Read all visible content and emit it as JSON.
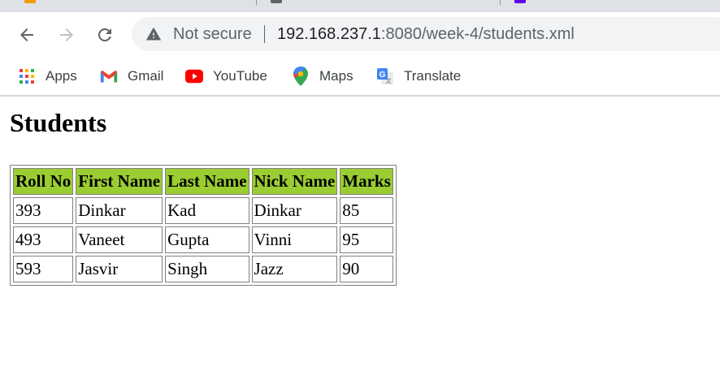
{
  "browser": {
    "security_label": "Not secure",
    "url_host": "192.168.237.1",
    "url_rest": ":8080/week-4/students.xml",
    "tab_icon_colors": [
      "#f29900",
      "#5f6368",
      "#6200ea"
    ]
  },
  "bookmarks": [
    {
      "label": "Apps",
      "icon": "apps-grid-icon"
    },
    {
      "label": "Gmail",
      "icon": "gmail-icon"
    },
    {
      "label": "YouTube",
      "icon": "youtube-icon"
    },
    {
      "label": "Maps",
      "icon": "maps-icon"
    },
    {
      "label": "Translate",
      "icon": "translate-icon"
    }
  ],
  "page": {
    "title": "Students",
    "table": {
      "headers": [
        "Roll No",
        "First Name",
        "Last Name",
        "Nick Name",
        "Marks"
      ],
      "rows": [
        [
          "393",
          "Dinkar",
          "Kad",
          "Dinkar",
          "85"
        ],
        [
          "493",
          "Vaneet",
          "Gupta",
          "Vinni",
          "95"
        ],
        [
          "593",
          "Jasvir",
          "Singh",
          "Jazz",
          "90"
        ]
      ],
      "header_color": "#9acd32"
    }
  }
}
